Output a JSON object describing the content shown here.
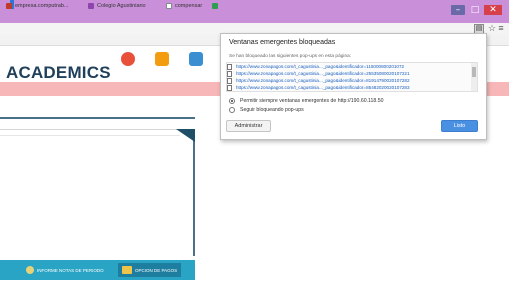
{
  "browser": {
    "bookmarks": [
      {
        "label": "empresa.computrab...",
        "icon": "mail-icon",
        "color": "#c0392b"
      },
      {
        "label": "Colegio Agustiniano",
        "icon": "school-icon",
        "color": "#8e44ad"
      },
      {
        "label": "compensar",
        "icon": "page-icon",
        "color": "#7f8c8d"
      },
      {
        "label": "",
        "icon": "green-icon",
        "color": "#2e9e4f"
      }
    ]
  },
  "site": {
    "brand": "ACADEMICS",
    "tabs": [
      {
        "label": "INFORME NOTAS DE PERIODO"
      },
      {
        "label": "OPCION DE PAGOS"
      }
    ]
  },
  "popup": {
    "title": "Ventanas emergentes bloqueadas",
    "description": "Se han bloqueado las siguientes pop-ups en esta página:",
    "blocked": [
      "https://www.zonapagos.com/t_cagustinia..._pago&identificador=115000800201072 ",
      "https://www.zonapagos.com/t_cagustinia..._pago&identificador=25535080020107221",
      "https://www.zonapagos.com/t_cagustinia..._pago&identificador=81914790020107282",
      "https://www.zonapagos.com/t_cagustinia..._pago&identificador=85482020020107283"
    ],
    "options": [
      {
        "label": "Permitir siempre ventanas emergentes de http://190.60.118.50",
        "selected": true
      },
      {
        "label": "Seguir bloqueando pop-ups",
        "selected": false
      }
    ],
    "manage_label": "Administrar",
    "done_label": "Listo"
  }
}
